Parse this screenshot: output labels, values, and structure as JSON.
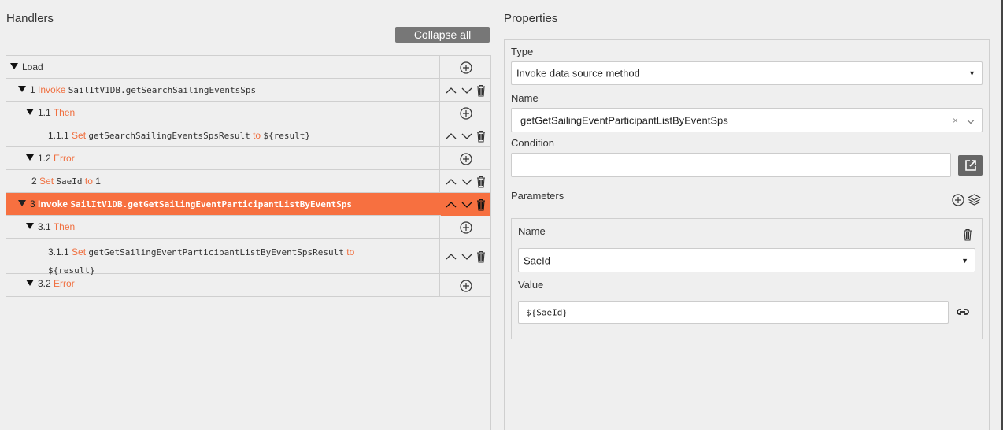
{
  "handlers": {
    "title": "Handlers",
    "collapse_label": "Collapse all",
    "rows": [
      {
        "num": "",
        "keyword": "Load",
        "text": "",
        "to": "",
        "value": ""
      },
      {
        "num": "1",
        "keyword": "Invoke",
        "text": "SailItV1DB.getSearchSailingEventsSps",
        "to": "",
        "value": ""
      },
      {
        "num": "1.1",
        "keyword": "Then",
        "text": "",
        "to": "",
        "value": ""
      },
      {
        "num": "1.1.1",
        "keyword": "Set",
        "text": "getSearchSailingEventsSpsResult",
        "to": "to",
        "value": "${result}"
      },
      {
        "num": "1.2",
        "keyword": "Error",
        "text": "",
        "to": "",
        "value": ""
      },
      {
        "num": "2",
        "keyword": "Set",
        "text": "SaeId",
        "to": "to",
        "value": "1"
      },
      {
        "num": "3",
        "keyword": "Invoke",
        "text": "SailItV1DB.getGetSailingEventParticipantListByEventSps",
        "to": "",
        "value": ""
      },
      {
        "num": "3.1",
        "keyword": "Then",
        "text": "",
        "to": "",
        "value": ""
      },
      {
        "num": "3.1.1",
        "keyword": "Set",
        "text": "getGetSailingEventParticipantListByEventSpsResult",
        "to": "to",
        "value": "${result}"
      },
      {
        "num": "3.2",
        "keyword": "Error",
        "text": "",
        "to": "",
        "value": ""
      }
    ]
  },
  "properties": {
    "title": "Properties",
    "type_label": "Type",
    "type_value": "Invoke data source method",
    "name_label": "Name",
    "name_value": "getGetSailingEventParticipantListByEventSps",
    "name_clear": "×",
    "condition_label": "Condition",
    "condition_value": "",
    "parameters_label": "Parameters",
    "param": {
      "name_label": "Name",
      "name_value": "SaeId",
      "value_label": "Value",
      "value_value": "${SaeId}"
    }
  },
  "colors": {
    "accent": "#f77040",
    "keyword": "#f07040",
    "button": "#777777"
  }
}
